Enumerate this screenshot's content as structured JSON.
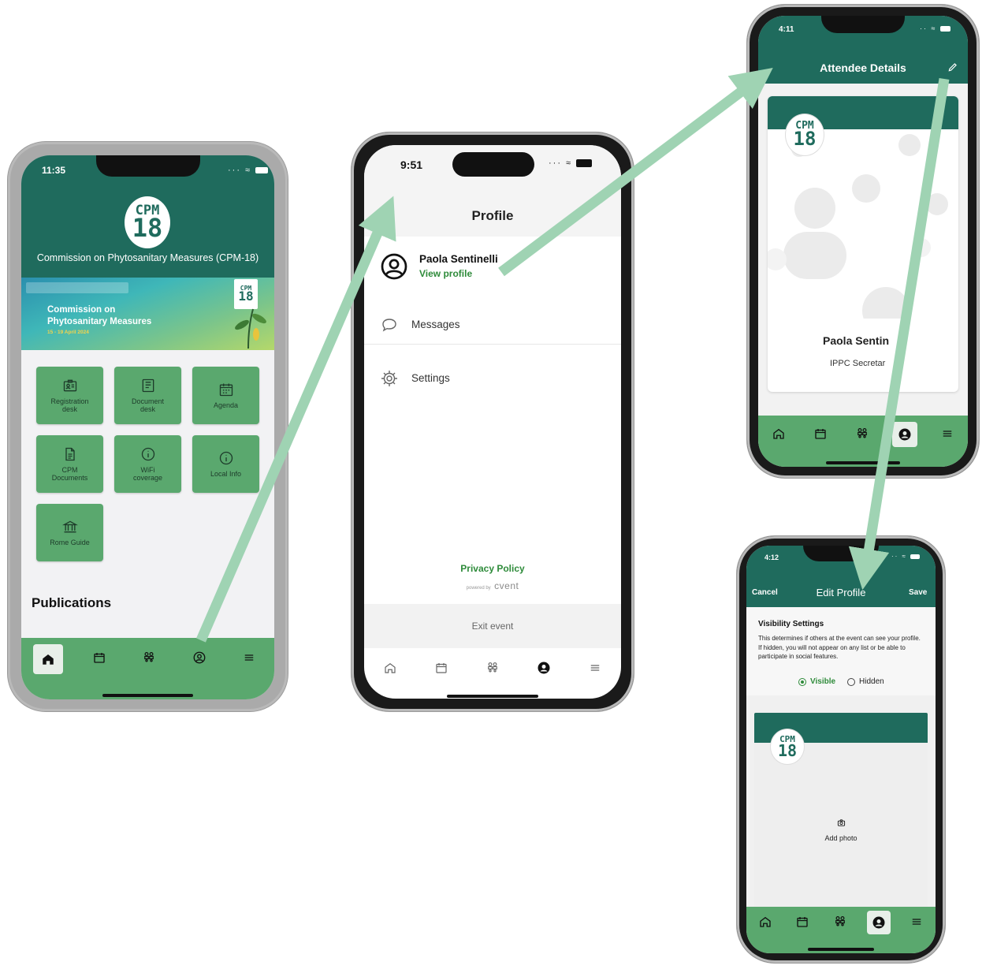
{
  "colors": {
    "brand_dark": "#1f6b5d",
    "brand_green": "#5aa86e",
    "tile_green": "#5aa86e",
    "link_green": "#2e8b3a",
    "arrow": "#9fd3b3"
  },
  "phone1": {
    "status_time": "11:35",
    "logo_top": "CPM",
    "logo_bottom": "18",
    "app_title": "Commission on Phytosanitary Measures (CPM-18)",
    "banner_line1": "Commission on",
    "banner_line2": "Phytosanitary Measures",
    "banner_dates": "15 - 19 April 2024",
    "tiles": [
      {
        "label": "Registration\ndesk",
        "icon": "id-card-icon"
      },
      {
        "label": "Document\ndesk",
        "icon": "document-icon"
      },
      {
        "label": "Agenda",
        "icon": "calendar-icon"
      },
      {
        "label": "CPM\nDocuments",
        "icon": "file-icon"
      },
      {
        "label": "WiFi\ncoverage",
        "icon": "info-icon"
      },
      {
        "label": "Local Info",
        "icon": "info-icon"
      },
      {
        "label": "Rome Guide",
        "icon": "building-icon"
      }
    ],
    "section_title": "Publications"
  },
  "phone2": {
    "status_time": "9:51",
    "page_title": "Profile",
    "user_name": "Paola Sentinelli",
    "view_profile": "View profile",
    "menu": [
      {
        "label": "Messages",
        "icon": "chat-bubble-icon"
      },
      {
        "label": "Settings",
        "icon": "gear-icon"
      }
    ],
    "privacy_policy": "Privacy Policy",
    "powered_by": "powered by",
    "brand": "cvent",
    "exit_event": "Exit event"
  },
  "phone3": {
    "status_time": "4:11",
    "page_title": "Attendee Details",
    "logo_top": "CPM",
    "logo_bottom": "18",
    "name": "Paola Sentin",
    "org": "IPPC Secretar"
  },
  "phone4": {
    "status_time": "4:12",
    "cancel": "Cancel",
    "page_title": "Edit Profile",
    "save": "Save",
    "visibility_title": "Visibility Settings",
    "visibility_desc": "This determines if others at the event can see your profile. If hidden, you will not appear on any list or be able to participate in social features.",
    "option_visible": "Visible",
    "option_hidden": "Hidden",
    "selected_option": "Visible",
    "logo_top": "CPM",
    "logo_bottom": "18",
    "add_photo": "Add photo"
  }
}
